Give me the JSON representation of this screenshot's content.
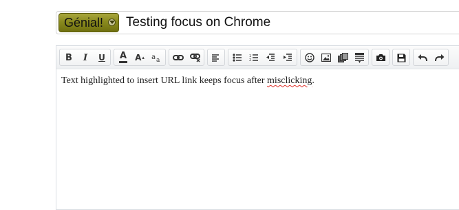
{
  "thread": {
    "prefix": "Génial!",
    "title": "Testing focus on Chrome"
  },
  "editor": {
    "content": {
      "before": "Text highlighted to insert URL link keeps focus after ",
      "misspelled": "misclicking",
      "after": "."
    }
  },
  "toolbar": {
    "bold": "B",
    "italic": "I",
    "underline": "U",
    "font_color": "A",
    "font_size": "A",
    "icons": [
      "bold",
      "italic",
      "underline",
      "font-color",
      "font-size",
      "font-family",
      "insert-link",
      "remove-link",
      "align-left",
      "bullet-list",
      "numbered-list",
      "outdent",
      "indent",
      "smilies",
      "image",
      "media",
      "quote",
      "screenshot",
      "save-draft",
      "undo",
      "redo"
    ]
  },
  "colors": {
    "prefix_bg": "#8a8a1e",
    "misspelling_underline": "#e0302a"
  }
}
